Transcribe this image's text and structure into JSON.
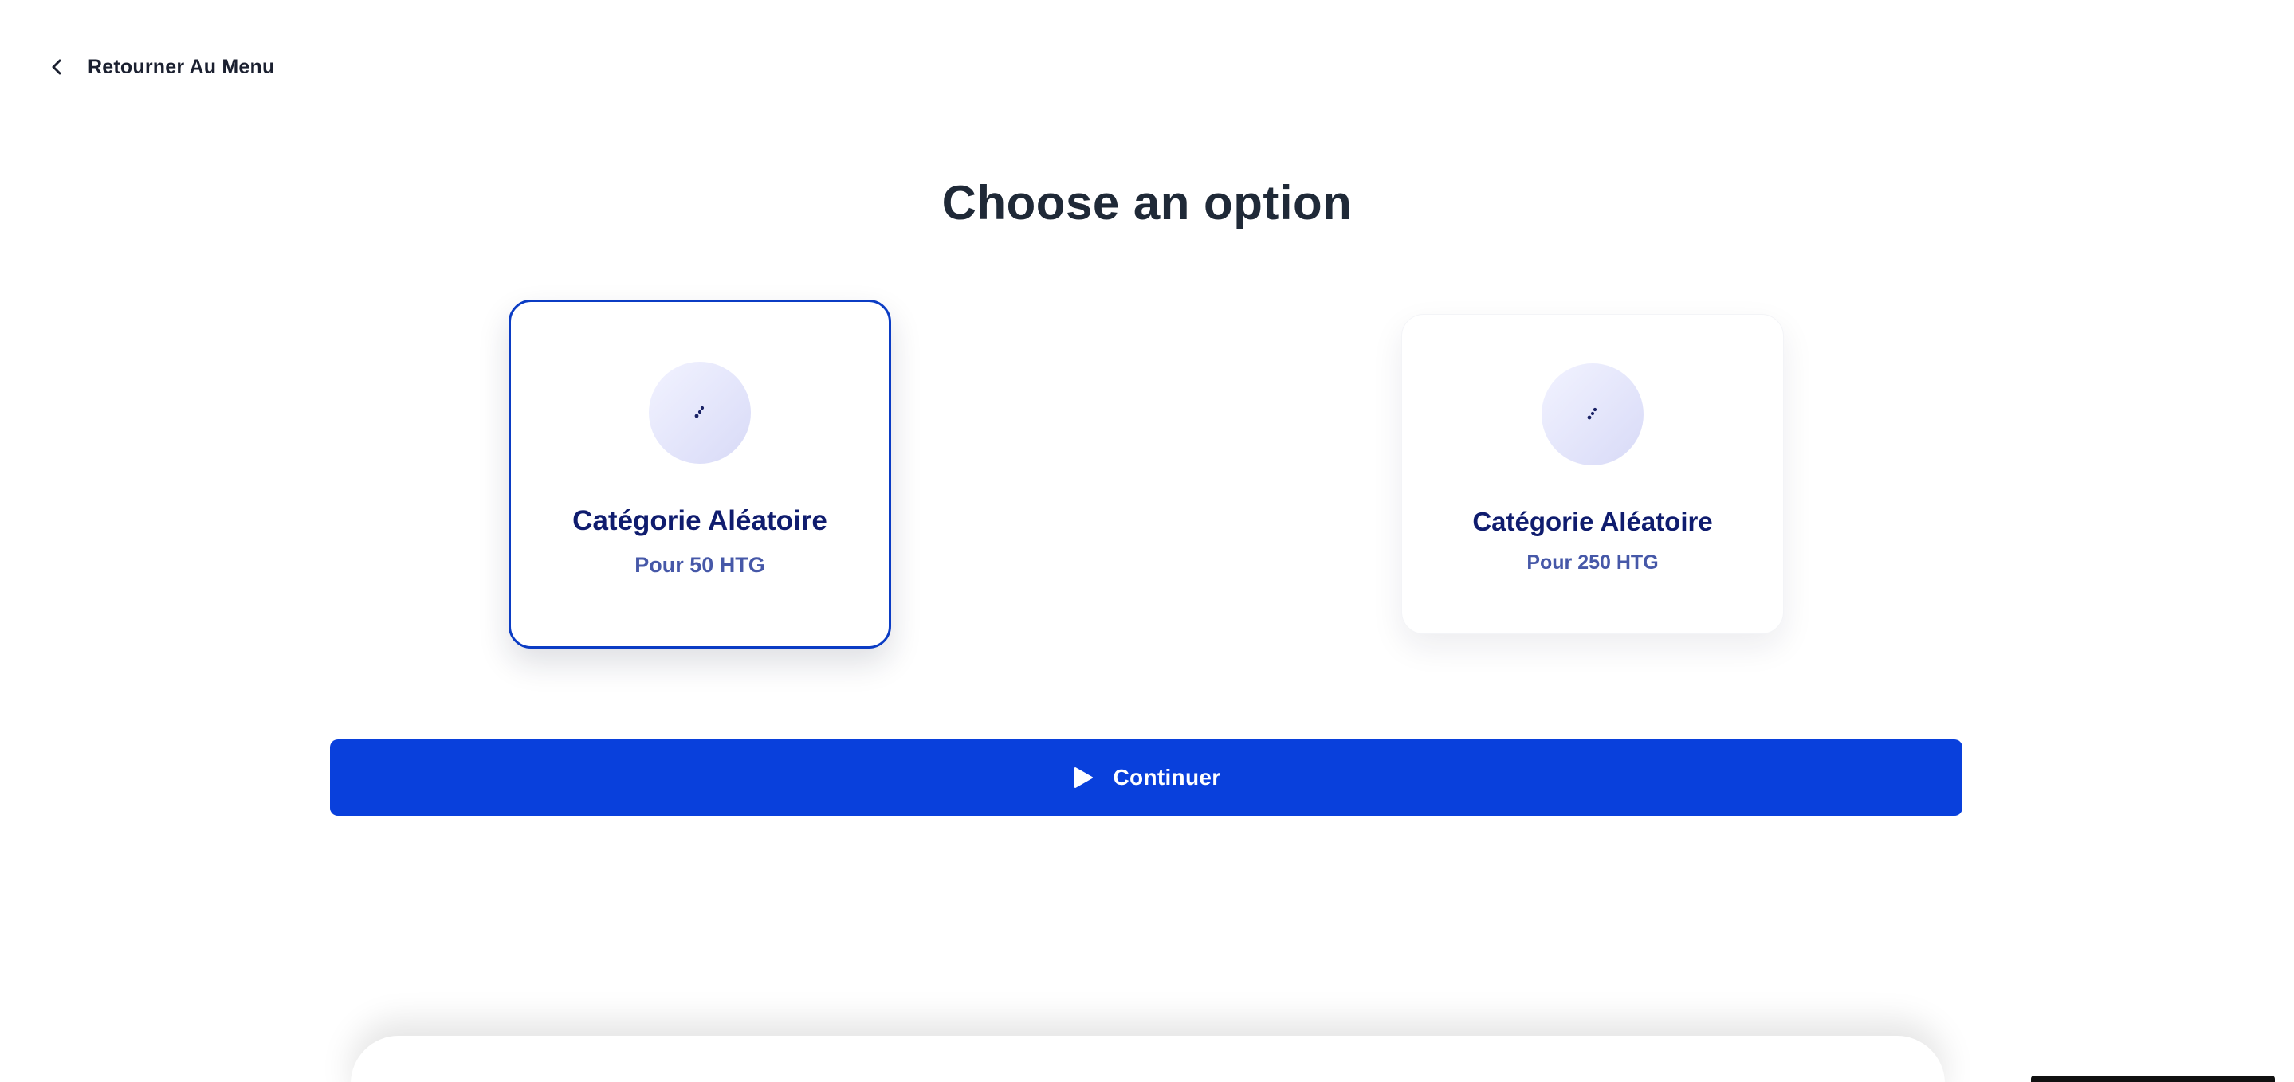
{
  "nav": {
    "back_label": "Retourner Au Menu",
    "back_icon": "chevron-left-icon"
  },
  "page": {
    "title": "Choose an option"
  },
  "options": [
    {
      "title": "Catégorie Aléatoire",
      "subtitle": "Pour 50 HTG",
      "icon": "dice-dots-icon",
      "selected": true
    },
    {
      "title": "Catégorie Aléatoire",
      "subtitle": "Pour 250 HTG",
      "icon": "dice-dots-icon",
      "selected": false
    }
  ],
  "actions": {
    "continue_label": "Continuer",
    "continue_icon": "play-icon"
  },
  "colors": {
    "primary": "#0940dc",
    "selected_border": "#0b3cc4",
    "card_title": "#0f1c6e",
    "card_subtitle": "#4658a8",
    "heading": "#1f2937"
  }
}
